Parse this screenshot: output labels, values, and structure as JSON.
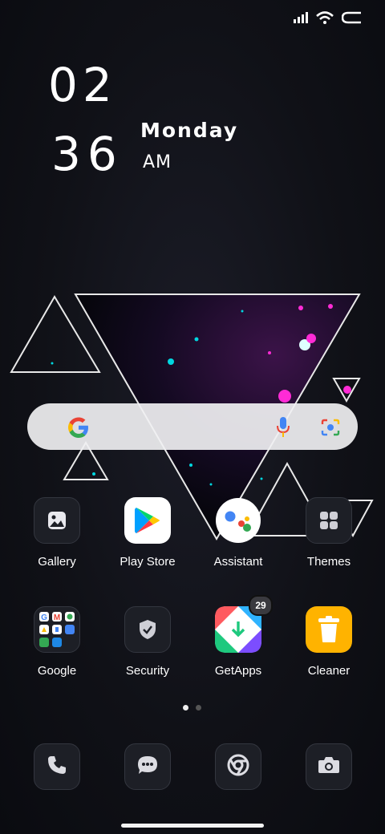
{
  "clock": {
    "hour": "02",
    "minute": "36",
    "day": "Monday",
    "ampm": "AM"
  },
  "status": {
    "icons": [
      "signal-icon",
      "wifi-icon",
      "battery-icon"
    ]
  },
  "apps_row1": [
    {
      "label": "Gallery",
      "icon": "gallery-icon"
    },
    {
      "label": "Play Store",
      "icon": "play-store-icon"
    },
    {
      "label": "Assistant",
      "icon": "assistant-icon"
    },
    {
      "label": "Themes",
      "icon": "themes-icon"
    }
  ],
  "apps_row2": [
    {
      "label": "Google",
      "icon": "google-folder-icon"
    },
    {
      "label": "Security",
      "icon": "security-icon"
    },
    {
      "label": "GetApps",
      "icon": "getapps-icon",
      "badge": "29"
    },
    {
      "label": "Cleaner",
      "icon": "cleaner-icon"
    }
  ],
  "page_indicator": {
    "pages": 2,
    "current": 1
  },
  "dock": [
    "phone-icon",
    "messages-icon",
    "chrome-icon",
    "camera-icon"
  ],
  "colors": {
    "accent": "#00c8d0",
    "magenta": "#ff2bd6",
    "cleaner": "#ffb300"
  }
}
